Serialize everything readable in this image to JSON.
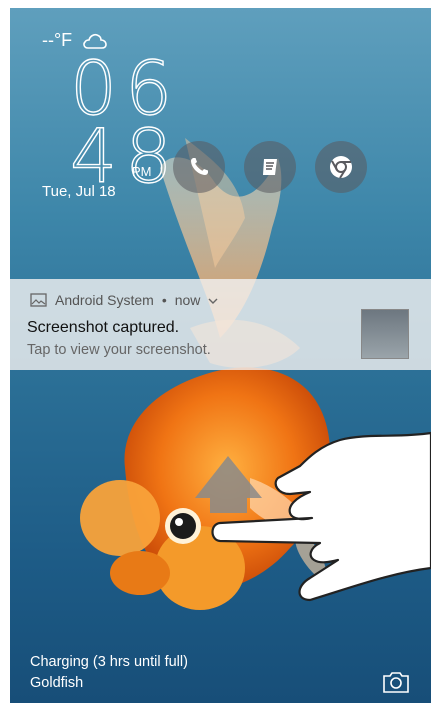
{
  "weather": {
    "temp": "--°F",
    "icon": "cloud-icon"
  },
  "clock": {
    "hours": "06",
    "minutes": "48",
    "ampm": "PM",
    "date": "Tue, Jul 18"
  },
  "shortcuts": [
    {
      "name": "phone",
      "icon": "phone-icon"
    },
    {
      "name": "notes",
      "icon": "notes-icon"
    },
    {
      "name": "chrome",
      "icon": "chrome-icon"
    }
  ],
  "notification": {
    "app": "Android System",
    "sep": "•",
    "time": "now",
    "title": "Screenshot captured.",
    "body": "Tap to view your screenshot."
  },
  "status": {
    "charging": "Charging (3 hrs until full)",
    "wallpaper": "Goldfish"
  },
  "colors": {
    "fish": "#f07a1a",
    "sky_top": "#5f9fbd",
    "sky_bottom": "#174e78"
  }
}
